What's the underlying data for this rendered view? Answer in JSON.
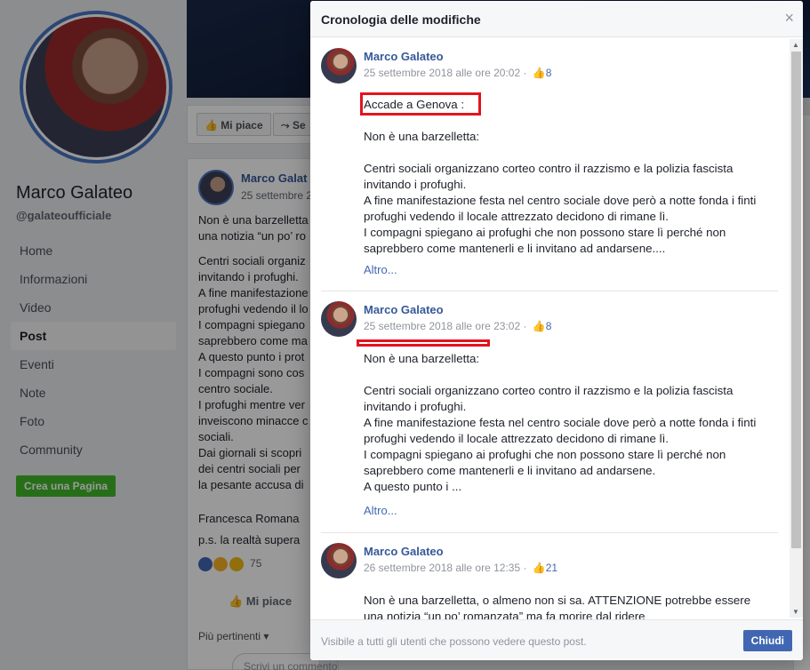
{
  "page": {
    "name": "Marco Galateo",
    "handle": "@galateoufficiale",
    "nav": [
      {
        "label": "Home",
        "active": false
      },
      {
        "label": "Informazioni",
        "active": false
      },
      {
        "label": "Video",
        "active": false
      },
      {
        "label": "Post",
        "active": true
      },
      {
        "label": "Eventi",
        "active": false
      },
      {
        "label": "Note",
        "active": false
      },
      {
        "label": "Foto",
        "active": false
      },
      {
        "label": "Community",
        "active": false
      }
    ],
    "create_page": "Crea una Pagina",
    "actions": {
      "like": "Mi piace",
      "follow": "Se"
    }
  },
  "post": {
    "author": "Marco Galat",
    "date": "25 settembre 2",
    "lines_top": [
      "Non è una barzelletta",
      "una notizia “un po’ ro"
    ],
    "lines_body": [
      "Centri sociali organiz",
      "invitando i profughi.",
      "A fine manifestazione",
      "profughi vedendo il lo",
      "I compagni spiegano",
      "saprebbero come ma",
      "A questo punto i prot",
      "I compagni sono cos",
      "centro sociale.",
      "I profughi mentre ver",
      "inveiscono minacce c",
      "sociali.",
      "Dai giornali si scopri",
      "dei centri sociali per",
      "la pesante accusa di"
    ],
    "signature": "Francesca Romana",
    "ps": "p.s. la realtà supera",
    "reaction_count": "75",
    "like_label": "Mi piace",
    "sort_label": "Più pertinenti",
    "comment_placeholder": "Scrivi un commento..."
  },
  "dialog": {
    "title": "Cronologia delle modifiche",
    "close_icon": "×",
    "entries": [
      {
        "author": "Marco Galateo",
        "date": "25 settembre 2018 alle ore 20:02",
        "likes": "8",
        "paragraphs": [
          [
            "Accade a Genova :"
          ],
          [
            "Non è una barzelletta:"
          ],
          [
            "Centri sociali organizzano corteo contro il razzismo e la polizia fascista",
            "invitando i profughi.",
            "A fine manifestazione festa nel centro sociale dove però a notte fonda i finti",
            "profughi vedendo il locale attrezzato decidono di rimane lì.",
            "I compagni spiegano ai profughi che non possono stare lì perché non",
            "saprebbero come mantenerli e li invitano ad andarsene...."
          ]
        ],
        "more": "Altro..."
      },
      {
        "author": "Marco Galateo",
        "date": "25 settembre 2018 alle ore 23:02",
        "likes": "8",
        "paragraphs": [
          [
            "Non è una barzelletta:"
          ],
          [
            "Centri sociali organizzano corteo contro il razzismo e la polizia fascista",
            "invitando i profughi.",
            "A fine manifestazione festa nel centro sociale dove però a notte fonda i finti",
            "profughi vedendo il locale attrezzato decidono di rimane lì.",
            "I compagni spiegano ai profughi che non possono stare lì perché non",
            "saprebbero come mantenerli e li invitano ad andarsene.",
            "A questo punto i ..."
          ]
        ],
        "more": "Altro..."
      },
      {
        "author": "Marco Galateo",
        "date": "26 settembre 2018 alle ore 12:35",
        "likes": "21",
        "paragraphs": [
          [
            "Non è una barzelletta, o almeno non si sa. ATTENZIONE potrebbe essere",
            "una notizia “un po’ romanzata” ma fa morire dal ridere"
          ]
        ]
      }
    ],
    "footer_text": "Visibile a tutti gli utenti che possono vedere questo post.",
    "close_button": "Chiudi"
  },
  "colors": {
    "link": "#365899",
    "accent": "#4267b2",
    "highlight": "#e2141f",
    "create_button": "#42b72a"
  }
}
